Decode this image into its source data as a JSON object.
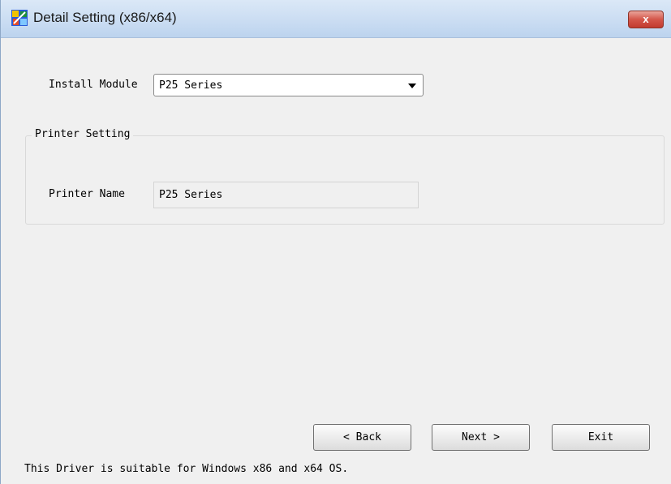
{
  "window": {
    "title": "Detail Setting (x86/x64)",
    "app_icon": "installer-icon",
    "close_label": "x"
  },
  "install_module": {
    "label": "Install Module",
    "selected": "P25 Series"
  },
  "printer_setting": {
    "group_title": "Printer Setting",
    "printer_name_label": "Printer Name",
    "printer_name_value": "P25 Series"
  },
  "buttons": {
    "back": "< Back",
    "next": "Next >",
    "exit": "Exit"
  },
  "status_text": "This Driver is suitable for Windows x86 and x64 OS.",
  "colors": {
    "titlebar": "#c9dcf2",
    "close_button": "#d4564a",
    "window_bg": "#f0f0f0"
  }
}
